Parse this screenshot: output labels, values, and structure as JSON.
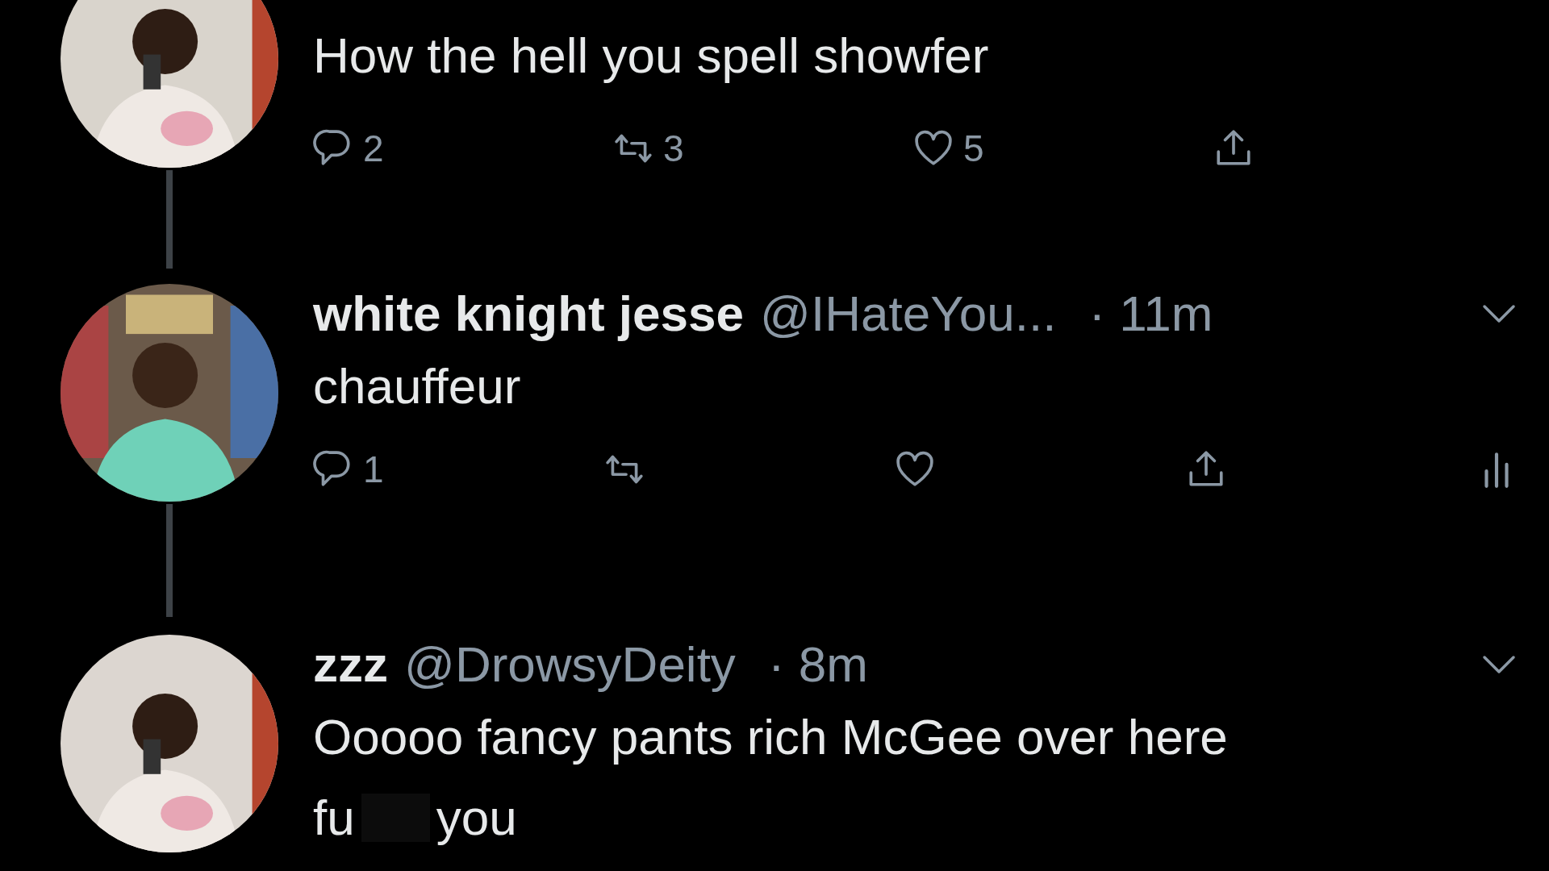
{
  "tweets": [
    {
      "body": [
        {
          "parts": [
            "How the hell you spell showfer"
          ]
        }
      ],
      "actions": [
        {
          "kind": "reply",
          "count": "2"
        },
        {
          "kind": "retweet",
          "count": "3"
        },
        {
          "kind": "like",
          "count": "5"
        },
        {
          "kind": "share"
        }
      ]
    },
    {
      "name": "white knight jesse",
      "handle": "@IHateYou...",
      "time": "· 11m",
      "body": [
        {
          "parts": [
            "chauffeur"
          ]
        }
      ],
      "actions": [
        {
          "kind": "reply",
          "count": "1"
        },
        {
          "kind": "retweet"
        },
        {
          "kind": "like"
        },
        {
          "kind": "share"
        },
        {
          "kind": "analytics"
        }
      ]
    },
    {
      "name": "zzz",
      "handle": "@DrowsyDeity",
      "time": "· 8m",
      "body": [
        {
          "parts": [
            "Ooooo fancy pants rich McGee over here"
          ]
        },
        {
          "parts": [
            "fu",
            "you"
          ]
        }
      ]
    }
  ]
}
